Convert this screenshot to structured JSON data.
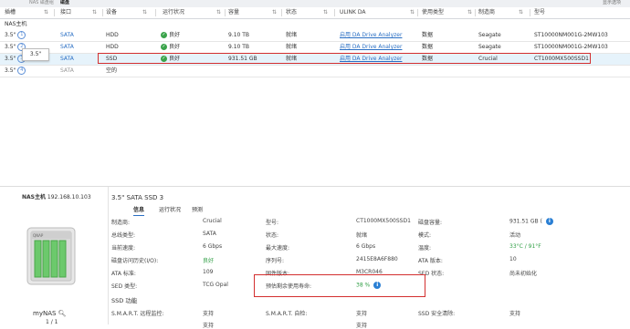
{
  "topbar": {
    "tab_left": "NAS 磁盘组",
    "tab_active": "磁盘",
    "right_label": "显示选项"
  },
  "table": {
    "headers": [
      "插槽",
      "接口",
      "设备",
      "运行状况",
      "容量",
      "状态",
      "ULINK DA",
      "使用类型",
      "制造商",
      "型号"
    ],
    "group_label": "NAS主机",
    "rows": [
      {
        "slot": "3.5\"",
        "num": "1",
        "iface": "SATA",
        "device": "HDD",
        "health": "良好",
        "capacity": "9.10 TB",
        "status": "就绪",
        "da": "启用 DA Drive Analyzer",
        "usage": "数据",
        "maker": "Seagate",
        "model": "ST10000NM001G-2MW103"
      },
      {
        "slot": "3.5\"",
        "num": "2",
        "iface": "SATA",
        "device": "HDD",
        "health": "良好",
        "capacity": "9.10 TB",
        "status": "就绪",
        "da": "启用 DA Drive Analyzer",
        "usage": "数据",
        "maker": "Seagate",
        "model": "ST10000NM001G-2MW103"
      },
      {
        "slot": "3.5\"",
        "num": "3",
        "iface": "SATA",
        "device": "SSD",
        "health": "良好",
        "capacity": "931.51 GB",
        "status": "就绪",
        "da": "启用 DA Drive Analyzer",
        "usage": "数据",
        "maker": "Crucial",
        "model": "CT1000MX500SSD1"
      },
      {
        "slot": "3.5\"",
        "num": "4",
        "iface": "SATA",
        "device": "空的",
        "health": "",
        "capacity": "",
        "status": "",
        "da": "",
        "usage": "",
        "maker": "",
        "model": ""
      }
    ],
    "tooltip": "3.5\""
  },
  "left_panel": {
    "host": "NAS主机",
    "ip": "192.168.10.103",
    "name": "myNAS",
    "page": "1 / 1"
  },
  "detail": {
    "title": "3.5\" SATA SSD 3",
    "tabs": [
      "信息",
      "运行状况",
      "预测"
    ],
    "info": {
      "maker_lbl": "制造商:",
      "maker": "Crucial",
      "model_lbl": "型号:",
      "model": "CT1000MX500SSD1",
      "cap_lbl": "磁盘容量:",
      "cap": "931.51 GB (",
      "bus_lbl": "总线类型:",
      "bus": "SATA",
      "status_lbl": "状态:",
      "status": "就绪",
      "mode_lbl": "模式:",
      "mode": "活动",
      "speed_lbl": "当前速度:",
      "speed": "6 Gbps",
      "maxspeed_lbl": "最大速度:",
      "maxspeed": "6 Gbps",
      "temp_lbl": "温度:",
      "temp": "33°C / 91°F",
      "check_lbl": "磁盘访问历史(I/O):",
      "check": "良好",
      "serial_lbl": "序列号:",
      "serial": "2415E8A6F880",
      "ata_ver_lbl": "ATA 版本:",
      "ata_ver": "10",
      "ata_std_lbl": "ATA 标准:",
      "ata_std": "109",
      "fw_lbl": "固件版本:",
      "fw": "M3CR046",
      "sed_status_lbl": "SED 状态:",
      "sed_status": "尚未初始化",
      "sed_type_lbl": "SED 类型:",
      "sed_type": "TCG Opal",
      "life_lbl": "预估剩余使用寿命:",
      "life": "38 %",
      "ssd_func": "SSD 功能",
      "smart_lbl": "S.M.A.R.T. 远程监控:",
      "smart": "支持",
      "smart2_lbl": "S.M.A.R.T. 自检:",
      "smart2": "支持",
      "secure_lbl": "SSD 安全清除:",
      "secure": "支持",
      "r5_a": "支持",
      "r5_b": "支持"
    }
  }
}
